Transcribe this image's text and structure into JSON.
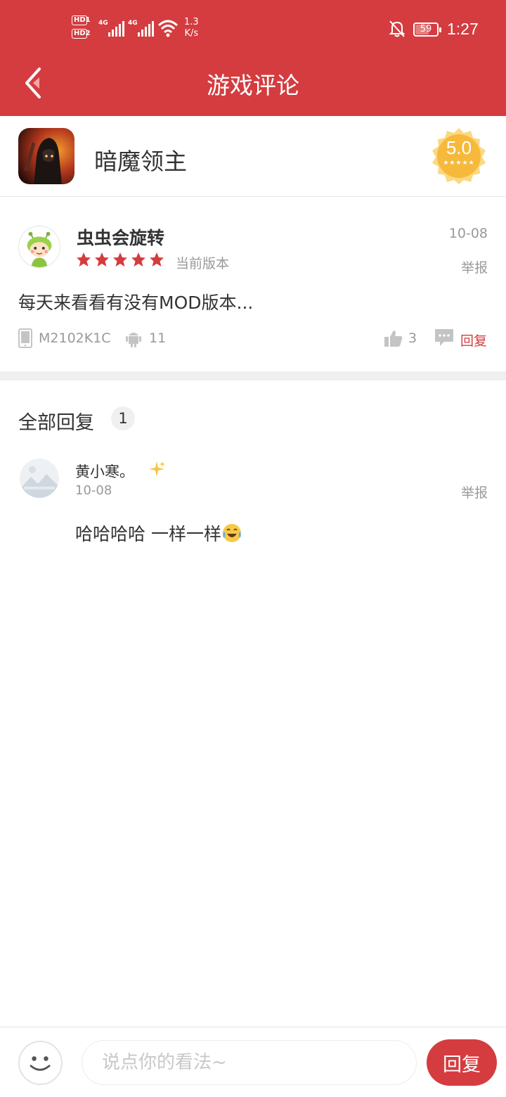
{
  "status_bar": {
    "hd1": "HD1",
    "hd2": "HD2",
    "net1": "4G",
    "net2": "4G",
    "speed_value": "1.3",
    "speed_unit": "K/s",
    "battery": "59",
    "time": "1:27",
    "icons": [
      "signal-icon",
      "wifi-icon",
      "bell-off-icon",
      "battery-icon"
    ]
  },
  "header": {
    "title": "游戏评论",
    "back_icon": "chevron-left-icon"
  },
  "game": {
    "name": "暗魔领主",
    "score": "5.0",
    "score_stars": "★★★★★"
  },
  "comment": {
    "author": "虫虫会旋转",
    "rating": 5,
    "version": "当前版本",
    "date": "10-08",
    "report": "举报",
    "text": "每天来看看有没有MOD版本...",
    "device": "M2102K1C",
    "android_version": "11",
    "likes": "3",
    "reply_label": "回复"
  },
  "replies": {
    "title": "全部回复",
    "count": "1",
    "items": [
      {
        "name": "黄小寒。",
        "date": "10-08",
        "report": "举报",
        "text": "哈哈哈哈 一样一样"
      }
    ]
  },
  "bottom": {
    "placeholder": "说点你的看法~",
    "send_label": "回复"
  },
  "colors": {
    "brand": "#d43c3f",
    "badge": "#f6b93b",
    "muted": "#999999"
  }
}
